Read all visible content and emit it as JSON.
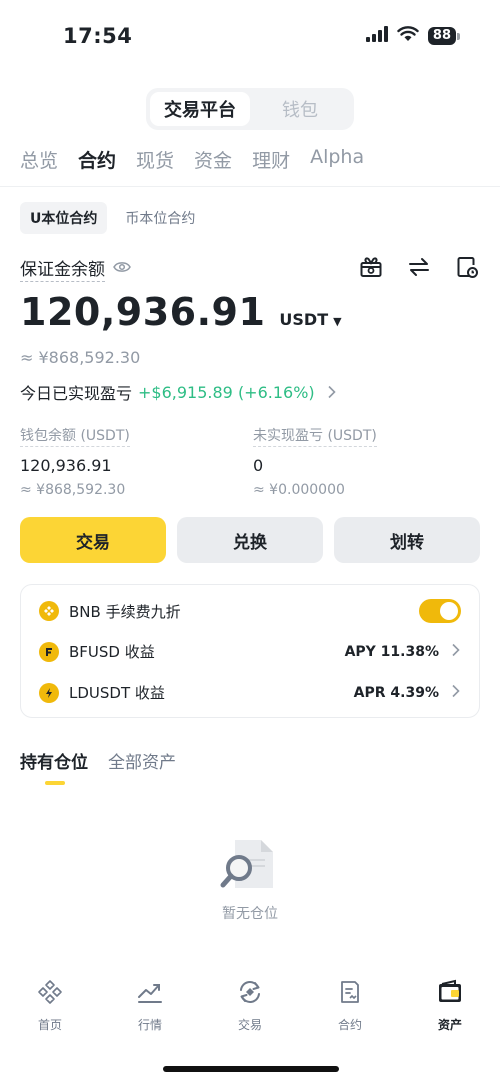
{
  "status_bar": {
    "time": "17:54",
    "battery": "88"
  },
  "segment": {
    "items": [
      "交易平台",
      "钱包"
    ],
    "active": 0
  },
  "main_tabs": [
    "总览",
    "合约",
    "现货",
    "资金",
    "理财",
    "Alpha"
  ],
  "sub_tabs": [
    "U本位合约",
    "币本位合约"
  ],
  "margin": {
    "label": "保证金余额",
    "value": "120,936.91",
    "unit": "USDT",
    "approx": "≈ ¥868,592.30"
  },
  "pnl": {
    "label": "今日已实现盈亏",
    "value": "+$6,915.89 (+6.16%)"
  },
  "wallet_balance": {
    "label": "钱包余额 (USDT)",
    "value": "120,936.91",
    "approx": "≈ ¥868,592.30"
  },
  "unrealized": {
    "label": "未实现盈亏 (USDT)",
    "value": "0",
    "approx": "≈ ¥0.000000"
  },
  "actions": [
    "交易",
    "兑换",
    "划转"
  ],
  "card": {
    "bnb_label": "BNB 手续费九折",
    "bfusd_label": "BFUSD 收益",
    "bfusd_value": "APY 11.38%",
    "ldusdt_label": "LDUSDT 收益",
    "ldusdt_value": "APR 4.39%"
  },
  "holdings_tabs": [
    "持有仓位",
    "全部资产"
  ],
  "empty_text": "暂无仓位",
  "bottom_nav": [
    "首页",
    "行情",
    "交易",
    "合约",
    "资产"
  ],
  "colors": {
    "accent": "#fcd535",
    "profit": "#2ebd85",
    "text": "#1e2329",
    "muted": "#929aa5"
  }
}
